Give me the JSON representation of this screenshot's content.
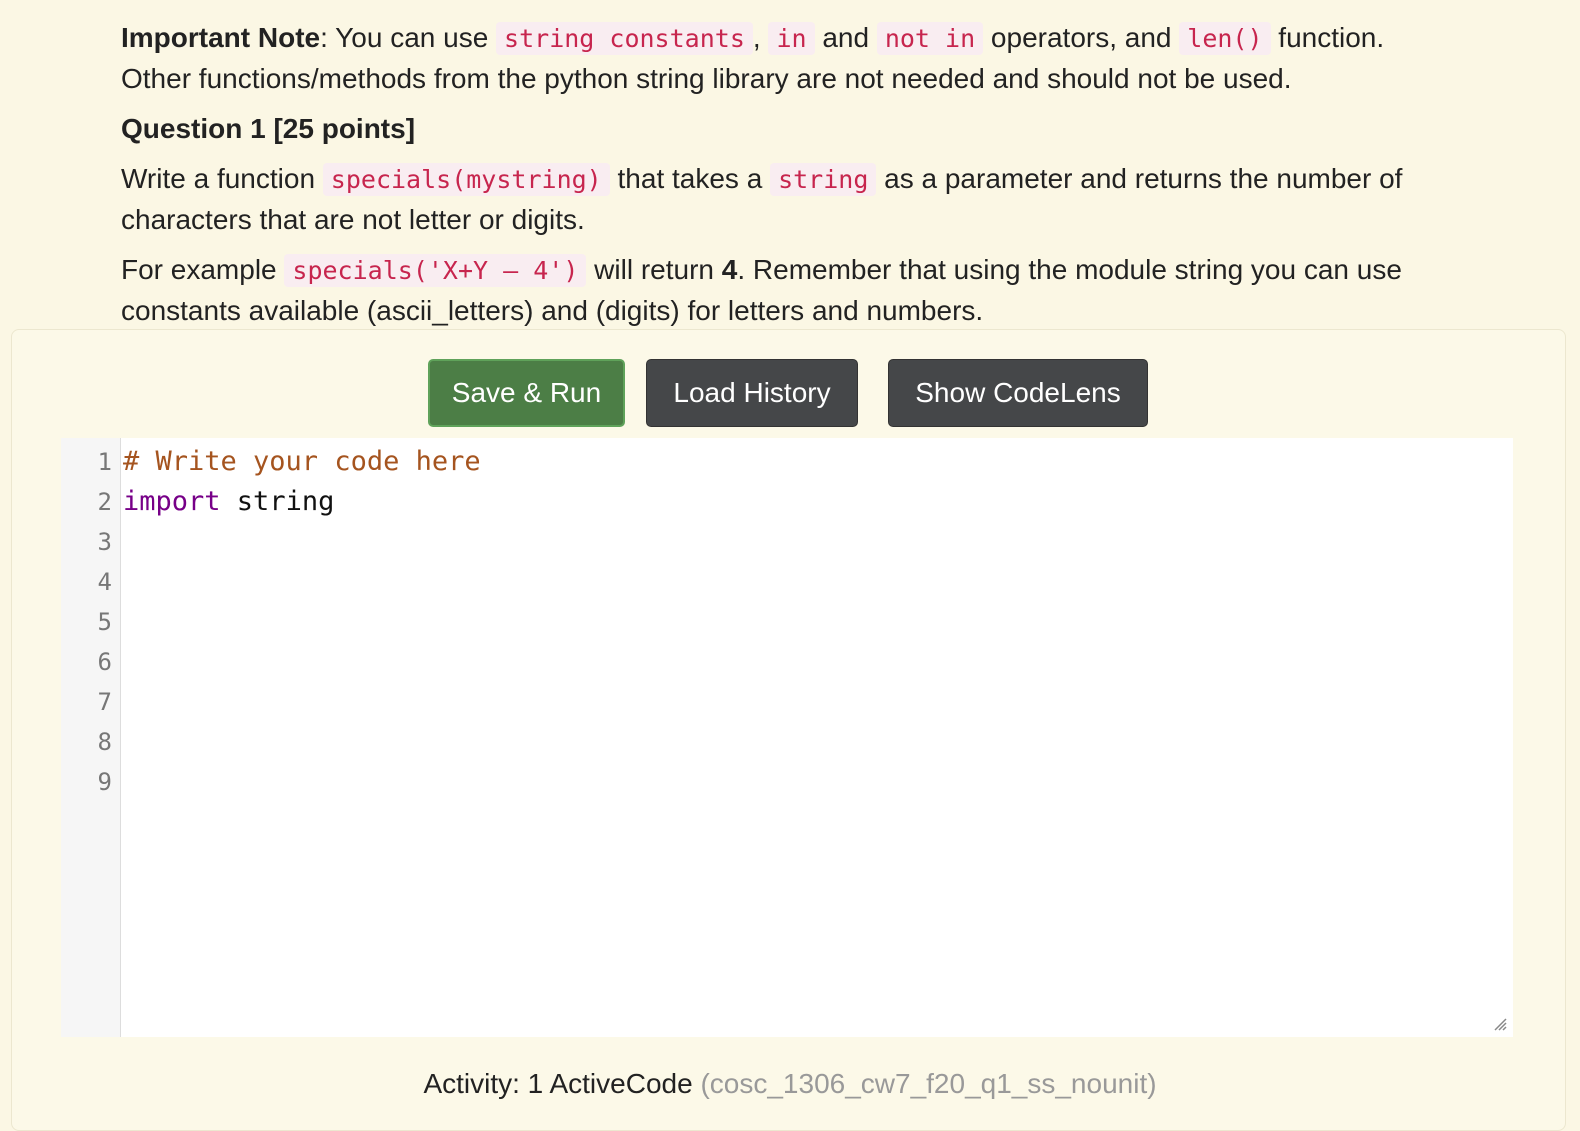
{
  "instructions": {
    "note_label": "Important Note",
    "note_text_1": ": You can use ",
    "code_string_constants": "string constants",
    "comma": ",",
    "code_in": "in",
    "and": " and ",
    "code_not_in": "not in",
    "operators_and": " operators, and ",
    "code_len": "len()",
    "function_text": " function.",
    "note_text_2": "Other functions/methods from the python string library are not needed and should not be used.",
    "question_title": "Question 1 [25 points]",
    "q_text_1": "Write a function ",
    "code_specials": "specials(mystring)",
    "q_text_2": " that takes a ",
    "code_string": "string",
    "q_text_3": " as a parameter and returns the number of characters that are not letter or digits.",
    "ex_text_1": "For example ",
    "code_example": "specials('X+Y – 4')",
    "ex_text_2": " will return ",
    "ex_result": "4",
    "ex_text_3": ". Remember that using the module string you can use constants available (ascii_letters) and (digits) for letters and numbers."
  },
  "toolbar": {
    "save_run_label": "Save & Run",
    "load_history_label": "Load History",
    "show_codelens_label": "Show CodeLens"
  },
  "editor": {
    "line_numbers": [
      "1",
      "2",
      "3",
      "4",
      "5",
      "6",
      "7",
      "8",
      "9"
    ],
    "line1_comment": "# Write your code here",
    "line2_keyword": "import",
    "line2_rest": " string"
  },
  "footer": {
    "activity_label": "Activity: 1 ActiveCode",
    "activity_id": " (cosc_1306_cw7_f20_q1_ss_nounit)"
  },
  "colors": {
    "page_bg": "#fbf7e4",
    "run_button": "#4c7e46",
    "dark_button": "#454749",
    "inline_code": "#c7254e",
    "comment": "#a5541f",
    "keyword": "#770088"
  }
}
